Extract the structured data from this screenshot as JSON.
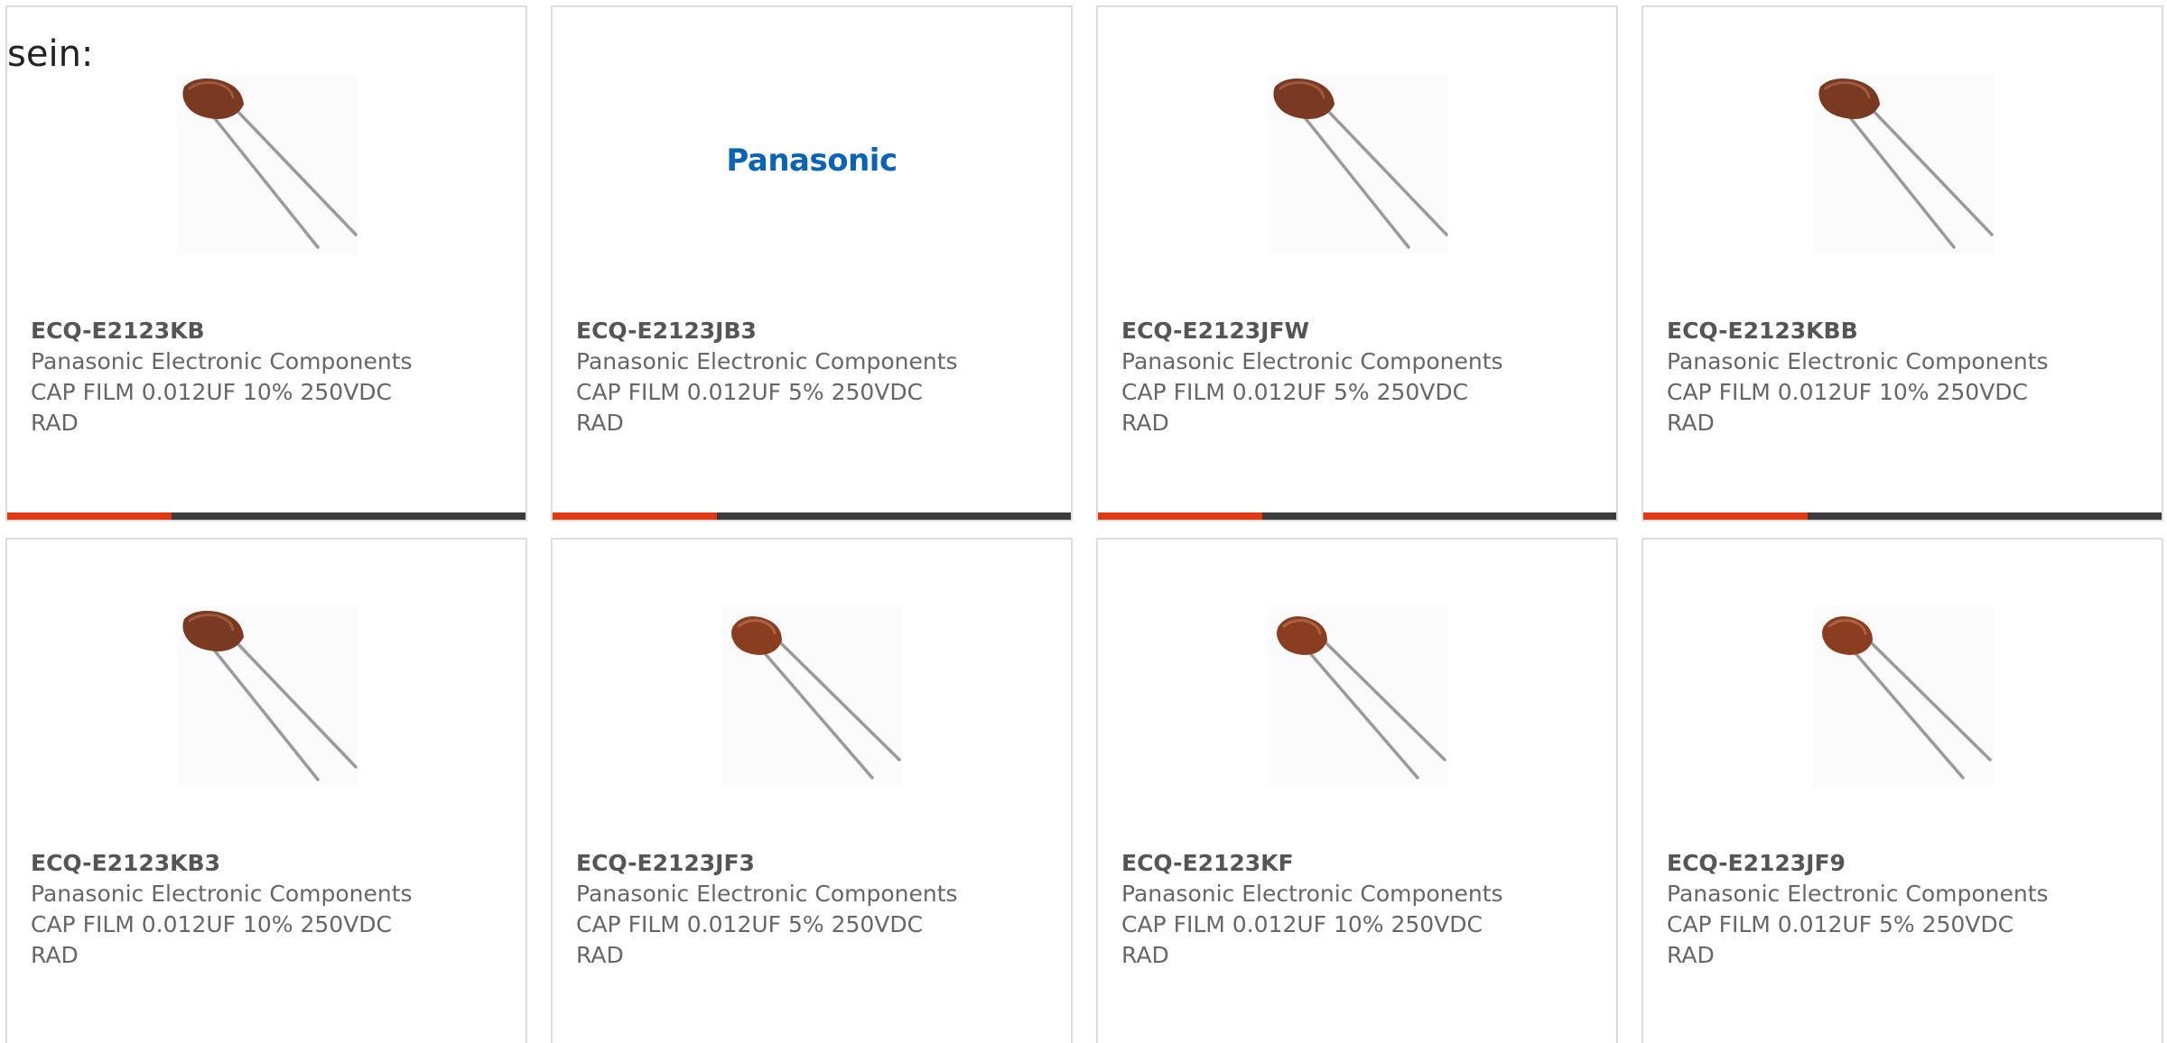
{
  "intro": {
    "text": "sein:"
  },
  "colors": {
    "accent": "#e03a12",
    "bar": "#3c3c3c",
    "brand": "#0a63b5"
  },
  "products": [
    {
      "part_number": "ECQ-E2123KB",
      "manufacturer": "Panasonic Electronic Components",
      "description": "CAP FILM 0.012UF 10% 250VDC RAD",
      "image": "capacitor-icon"
    },
    {
      "part_number": "ECQ-E2123JB3",
      "manufacturer": "Panasonic Electronic Components",
      "description": "CAP FILM 0.012UF 5% 250VDC RAD",
      "image": "panasonic-logo",
      "logo_text": "Panasonic"
    },
    {
      "part_number": "ECQ-E2123JFW",
      "manufacturer": "Panasonic Electronic Components",
      "description": "CAP FILM 0.012UF 5% 250VDC RAD",
      "image": "capacitor-icon"
    },
    {
      "part_number": "ECQ-E2123KBB",
      "manufacturer": "Panasonic Electronic Components",
      "description": "CAP FILM 0.012UF 10% 250VDC RAD",
      "image": "capacitor-icon"
    },
    {
      "part_number": "ECQ-E2123KB3",
      "manufacturer": "Panasonic Electronic Components",
      "description": "CAP FILM 0.012UF 10% 250VDC RAD",
      "image": "capacitor-icon"
    },
    {
      "part_number": "ECQ-E2123JF3",
      "manufacturer": "Panasonic Electronic Components",
      "description": "CAP FILM 0.012UF 5% 250VDC RAD",
      "image": "capacitor-icon"
    },
    {
      "part_number": "ECQ-E2123KF",
      "manufacturer": "Panasonic Electronic Components",
      "description": "CAP FILM 0.012UF 10% 250VDC RAD",
      "image": "capacitor-icon"
    },
    {
      "part_number": "ECQ-E2123JF9",
      "manufacturer": "Panasonic Electronic Components",
      "description": "CAP FILM 0.012UF 5% 250VDC RAD",
      "image": "capacitor-icon"
    }
  ]
}
